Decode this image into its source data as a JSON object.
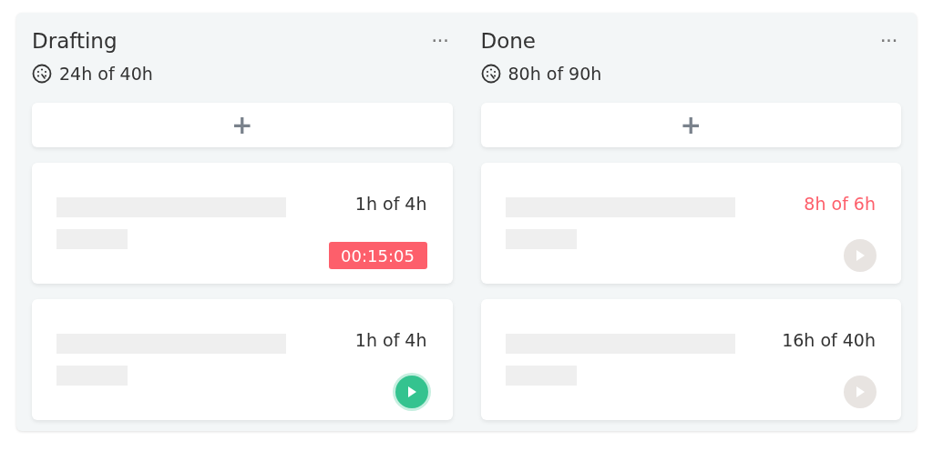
{
  "columns": [
    {
      "title": "Drafting",
      "menu": "···",
      "budget": "24h of 40h",
      "add_button": "+",
      "cards": [
        {
          "kind": "timer",
          "estimate": "1h of 4h",
          "overdue": false,
          "timer": "00:15:05"
        },
        {
          "kind": "play",
          "estimate": "1h of 4h",
          "overdue": false,
          "active": true
        }
      ]
    },
    {
      "title": "Done",
      "menu": "···",
      "budget": "80h of 90h",
      "add_button": "+",
      "cards": [
        {
          "kind": "play",
          "estimate": "8h of 6h",
          "overdue": true,
          "active": false
        },
        {
          "kind": "play",
          "estimate": "16h of 40h",
          "overdue": false,
          "active": false
        }
      ]
    }
  ]
}
